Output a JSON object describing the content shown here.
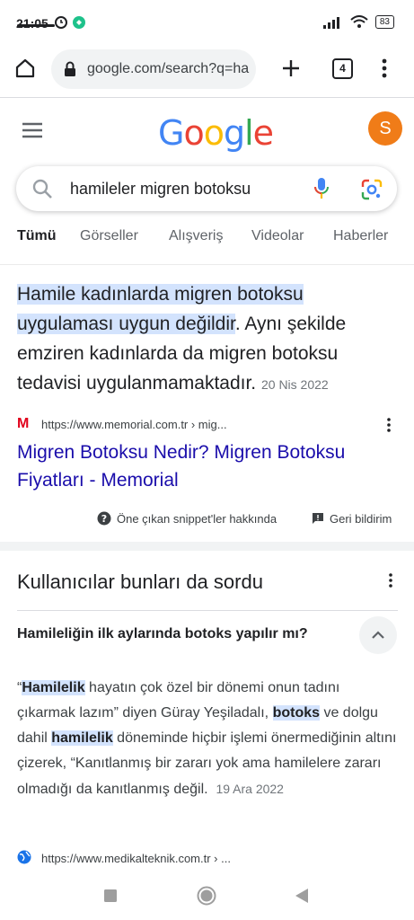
{
  "status": {
    "time": "21:05",
    "battery": "83"
  },
  "browser": {
    "url": "google.com/search?q=ha",
    "tab_count": "4"
  },
  "google": {
    "logo": "Google",
    "avatar_letter": "S"
  },
  "search": {
    "query": "hamileler migren botoksu"
  },
  "tabs": [
    "Tümü",
    "Görseller",
    "Alışveriş",
    "Videolar",
    "Haberler"
  ],
  "snippet": {
    "highlight": "Hamile kadınlarda migren botoksu uygulaması uygun değildir",
    "rest": ". Aynı şekilde emziren kadınlarda da migren botoksu tedavisi uygulanmamaktadır.",
    "date": "20 Nis 2022",
    "source_url": "https://www.memorial.com.tr › mig...",
    "result_title": "Migren Botoksu Nedir? Migren Botoksu Fiyatları - Memorial",
    "about": "Öne çıkan snippet'ler hakkında",
    "feedback": "Geri bildirim"
  },
  "paa": {
    "title": "Kullanıcılar bunları da sordu",
    "question": "Hamileliğin ilk aylarında botoks yapılır mı?",
    "answer": {
      "p1": "“",
      "b1": "Hamilelik",
      "p2": " hayatın çok özel bir dönemi onun tadını çıkarmak lazım” diyen Güray Yeşiladalı, ",
      "b2": "botoks",
      "p3": " ve dolgu dahil ",
      "b3": "hamilelik",
      "p4": " döneminde hiçbir işlemi önermediğinin altını çizerek, “Kanıtlanmış bir zararı yok ama hamilelere zararı olmadığı da kanıtlanmış değil."
    },
    "answer_date": "19 Ara 2022",
    "source_url": "https://www.medikalteknik.com.tr › ..."
  }
}
